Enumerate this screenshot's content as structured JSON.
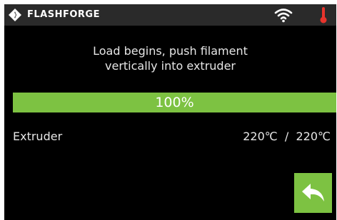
{
  "header": {
    "brand": "FLASHFORGE",
    "icons": [
      "flashforge-logo-icon",
      "wifi-icon",
      "thermometer-icon"
    ]
  },
  "message": {
    "line1": "Load begins, push filament",
    "line2": "vertically into extruder"
  },
  "progress": {
    "percent": 100,
    "label": "100%"
  },
  "extruder": {
    "label": "Extruder",
    "current_temp": "220℃",
    "separator": "/",
    "target_temp": "220℃"
  },
  "actions": {
    "back_icon": "back-arrow-icon"
  },
  "colors": {
    "accent": "#7dc242",
    "background": "#000000",
    "topbar": "#2a2a2a",
    "thermometer": "#e8342c"
  }
}
